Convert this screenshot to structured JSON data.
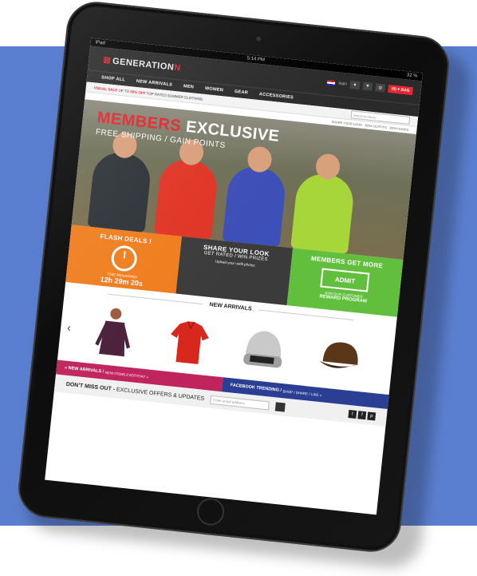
{
  "colors": {
    "background_band": "#5b7fd0",
    "brand_red": "#e3262f",
    "flash_orange": "#f07d1e",
    "members_green": "#62bf3e",
    "pink_banner": "#c0245c",
    "blue_banner": "#2a3f94"
  },
  "statusbar": {
    "device": "iPad",
    "time": "5:14 PM",
    "battery": "32 %"
  },
  "header": {
    "logo_main": "GENERATION",
    "logo_accent": "N",
    "login": "login",
    "cart_label": "(0) ♥ BAG"
  },
  "nav": {
    "items": [
      "SHOP ALL",
      "NEW ARRIVALS",
      "MEN",
      "WOMEN",
      "GEAR",
      "ACCESSORIES"
    ]
  },
  "promo": {
    "label": "VISUAL SALE",
    "text": "UP TO",
    "discount": "50% OFF",
    "tail": "TOP RATED SUMMER CLOTHING",
    "search_placeholder": "search products",
    "share_note": "SHARE YOUR LOOK · NEW OUTFITS · WISH FAVES"
  },
  "hero": {
    "title_red": "MEMBERS",
    "title_white": "EXCLUSIVE",
    "subtitle": "FREE SHIPPING / GAIN POINTS"
  },
  "tiles": {
    "flash": {
      "title": "FLASH DEALS !",
      "small": "TIME REMAINING",
      "countdown": "12h 29m 20s"
    },
    "share": {
      "title": "SHARE YOUR LOOK",
      "sub": "GET RATED / WIN PRIZES",
      "small": "Upload your outfit photos"
    },
    "members": {
      "title": "MEMBERS GET MORE",
      "admit": "ADMIT",
      "small": "JOIN OUR CUSTOMER",
      "program": "REWARD PROGRAM"
    }
  },
  "arrivals": {
    "heading": "NEW ARRIVALS",
    "prev_icon": "‹"
  },
  "banners": {
    "pink_main": "« NEW ARRIVALS /",
    "pink_sub": "NEW ITEMS EVERYDAY »",
    "blue_main": "FACEBOOK TRENDING /",
    "blue_sub": "SHOP / SHARE / LIKE »"
  },
  "newsletter": {
    "bold": "DON'T MISS OUT -",
    "rest": "EXCLUSIVE OFFERS & UPDATES",
    "email_placeholder": "Enter email address",
    "social": [
      "t",
      "f",
      "p"
    ]
  }
}
